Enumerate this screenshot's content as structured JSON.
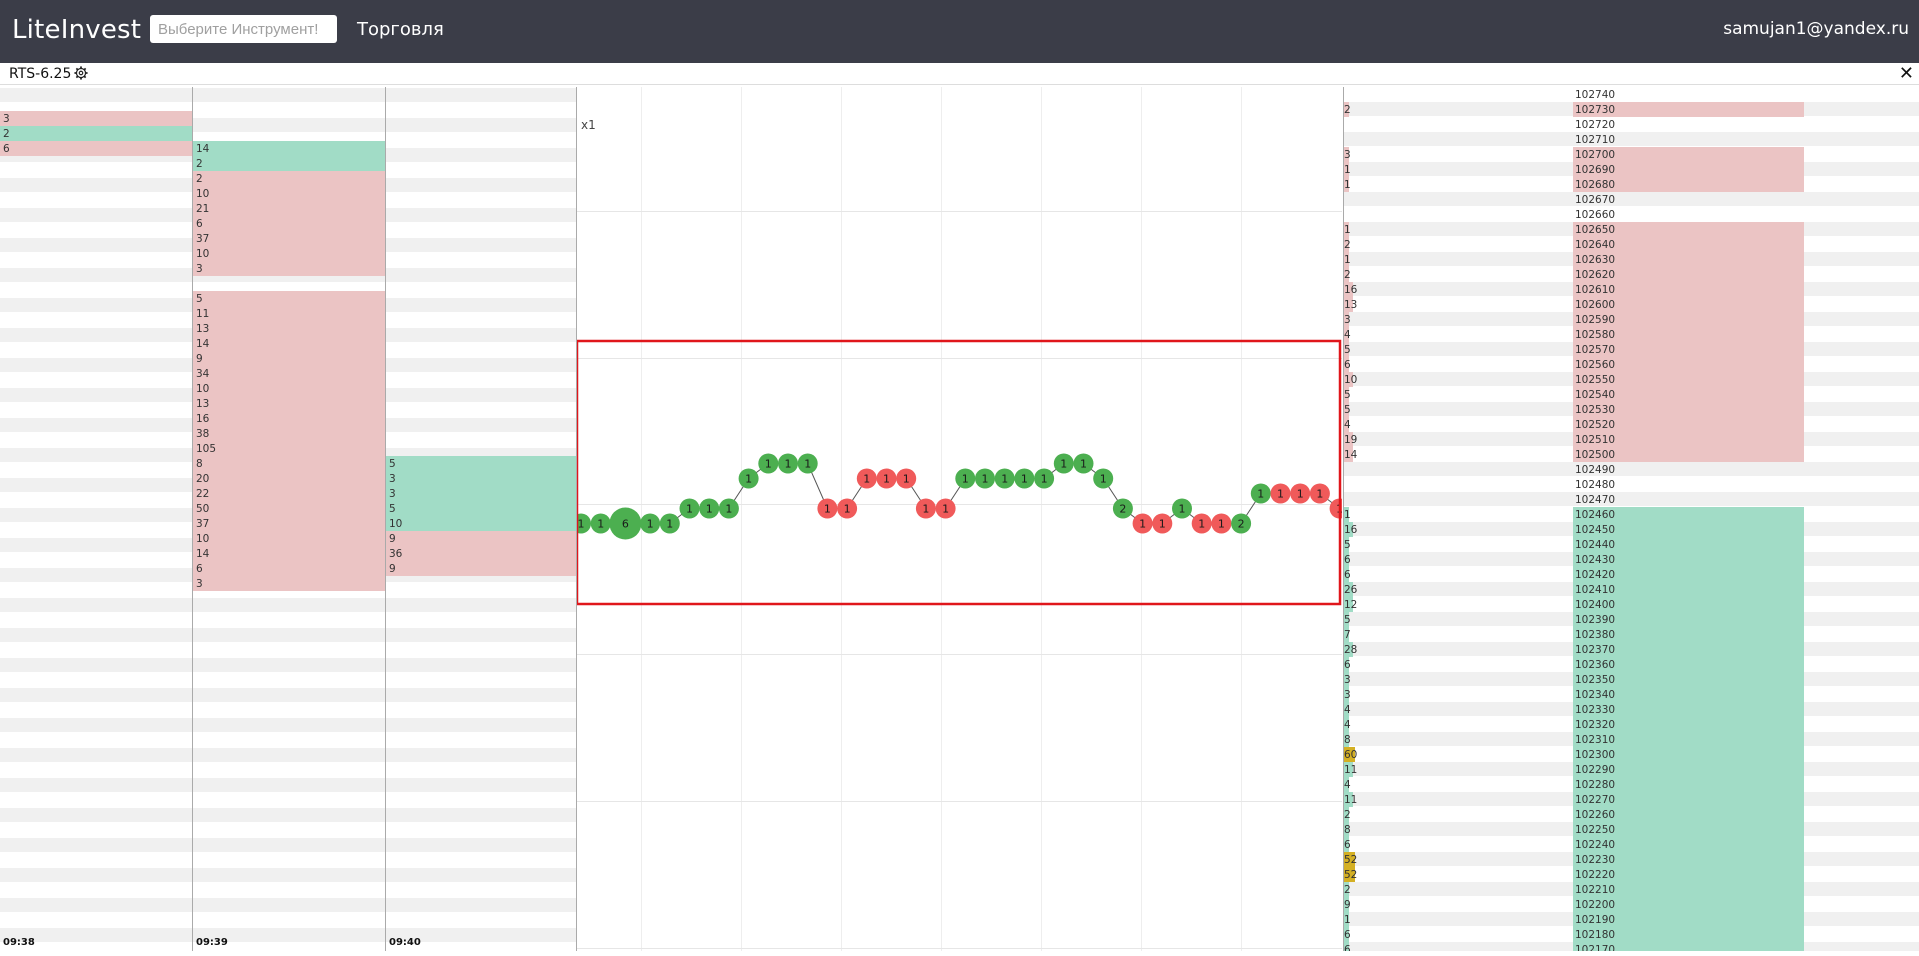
{
  "header": {
    "logo": "LiteInvest",
    "search_placeholder": "Выберите Инструмент!",
    "nav_trading": "Торговля",
    "user_email": "samujan1@yandex.ru"
  },
  "instrument": {
    "symbol": "RTS-6.25",
    "settings_icon": "gear-icon",
    "close_icon": "close-icon"
  },
  "colors": {
    "sell": "#ebc4c4",
    "buy": "#a1dcc6",
    "bubble_buy": "#4caf50",
    "bubble_sell": "#f05a5a",
    "highlight": "#e0161b",
    "header_bg": "#3b3d48",
    "yellow_mark": "#d4b024"
  },
  "time_columns": [
    {
      "time": "09:38",
      "rows": [
        {
          "row": 2,
          "v": "3",
          "side": "sell"
        },
        {
          "row": 3,
          "v": "2",
          "side": "buy"
        },
        {
          "row": 4,
          "v": "6",
          "side": "sell"
        }
      ]
    },
    {
      "time": "09:39",
      "rows": [
        {
          "row": 4,
          "v": "14",
          "side": "buy"
        },
        {
          "row": 5,
          "v": "2",
          "side": "buy"
        },
        {
          "row": 6,
          "v": "2",
          "side": "sell"
        },
        {
          "row": 7,
          "v": "10",
          "side": "sell"
        },
        {
          "row": 8,
          "v": "21",
          "side": "sell"
        },
        {
          "row": 9,
          "v": "6",
          "side": "sell"
        },
        {
          "row": 10,
          "v": "37",
          "side": "sell"
        },
        {
          "row": 11,
          "v": "10",
          "side": "sell"
        },
        {
          "row": 12,
          "v": "3",
          "side": "sell"
        },
        {
          "row": 14,
          "v": "5",
          "side": "sell"
        },
        {
          "row": 15,
          "v": "11",
          "side": "sell"
        },
        {
          "row": 16,
          "v": "13",
          "side": "sell"
        },
        {
          "row": 17,
          "v": "14",
          "side": "sell"
        },
        {
          "row": 18,
          "v": "9",
          "side": "sell"
        },
        {
          "row": 19,
          "v": "34",
          "side": "sell"
        },
        {
          "row": 20,
          "v": "10",
          "side": "sell"
        },
        {
          "row": 21,
          "v": "13",
          "side": "sell"
        },
        {
          "row": 22,
          "v": "16",
          "side": "sell"
        },
        {
          "row": 23,
          "v": "38",
          "side": "sell"
        },
        {
          "row": 24,
          "v": "105",
          "side": "sell"
        },
        {
          "row": 25,
          "v": "8",
          "side": "sell"
        },
        {
          "row": 26,
          "v": "20",
          "side": "sell"
        },
        {
          "row": 27,
          "v": "22",
          "side": "sell"
        },
        {
          "row": 28,
          "v": "50",
          "side": "sell"
        },
        {
          "row": 29,
          "v": "37",
          "side": "sell"
        },
        {
          "row": 30,
          "v": "10",
          "side": "sell"
        },
        {
          "row": 31,
          "v": "14",
          "side": "sell"
        },
        {
          "row": 32,
          "v": "6",
          "side": "sell"
        },
        {
          "row": 33,
          "v": "3",
          "side": "sell"
        }
      ]
    },
    {
      "time": "09:40",
      "rows": [
        {
          "row": 25,
          "v": "5",
          "side": "buy"
        },
        {
          "row": 26,
          "v": "3",
          "side": "buy"
        },
        {
          "row": 27,
          "v": "3",
          "side": "buy"
        },
        {
          "row": 28,
          "v": "5",
          "side": "buy"
        },
        {
          "row": 29,
          "v": "10",
          "side": "buy"
        },
        {
          "row": 30,
          "v": "9",
          "side": "sell"
        },
        {
          "row": 31,
          "v": "36",
          "side": "sell"
        },
        {
          "row": 32,
          "v": "9",
          "side": "sell"
        }
      ]
    }
  ],
  "chart": {
    "scale_label": "x1",
    "trades": [
      {
        "v": "1",
        "row": 29,
        "side": "buy"
      },
      {
        "v": "1",
        "row": 29,
        "side": "buy"
      },
      {
        "v": "6",
        "row": 29,
        "side": "buy",
        "big": true
      },
      {
        "v": "1",
        "row": 29,
        "side": "buy"
      },
      {
        "v": "1",
        "row": 29,
        "side": "buy"
      },
      {
        "v": "1",
        "row": 28,
        "side": "buy"
      },
      {
        "v": "1",
        "row": 28,
        "side": "buy"
      },
      {
        "v": "1",
        "row": 28,
        "side": "buy"
      },
      {
        "v": "1",
        "row": 26,
        "side": "buy"
      },
      {
        "v": "1",
        "row": 25,
        "side": "buy"
      },
      {
        "v": "1",
        "row": 25,
        "side": "buy"
      },
      {
        "v": "1",
        "row": 25,
        "side": "buy"
      },
      {
        "v": "1",
        "row": 28,
        "side": "sell"
      },
      {
        "v": "1",
        "row": 28,
        "side": "sell"
      },
      {
        "v": "1",
        "row": 26,
        "side": "sell"
      },
      {
        "v": "1",
        "row": 26,
        "side": "sell"
      },
      {
        "v": "1",
        "row": 26,
        "side": "sell"
      },
      {
        "v": "1",
        "row": 28,
        "side": "sell"
      },
      {
        "v": "1",
        "row": 28,
        "side": "sell"
      },
      {
        "v": "1",
        "row": 26,
        "side": "buy"
      },
      {
        "v": "1",
        "row": 26,
        "side": "buy"
      },
      {
        "v": "1",
        "row": 26,
        "side": "buy"
      },
      {
        "v": "1",
        "row": 26,
        "side": "buy"
      },
      {
        "v": "1",
        "row": 26,
        "side": "buy"
      },
      {
        "v": "1",
        "row": 25,
        "side": "buy"
      },
      {
        "v": "1",
        "row": 25,
        "side": "buy"
      },
      {
        "v": "1",
        "row": 26,
        "side": "buy"
      },
      {
        "v": "2",
        "row": 28,
        "side": "buy"
      },
      {
        "v": "1",
        "row": 29,
        "side": "sell"
      },
      {
        "v": "1",
        "row": 29,
        "side": "sell"
      },
      {
        "v": "1",
        "row": 28,
        "side": "buy"
      },
      {
        "v": "1",
        "row": 29,
        "side": "sell"
      },
      {
        "v": "1",
        "row": 29,
        "side": "sell"
      },
      {
        "v": "2",
        "row": 29,
        "side": "buy"
      },
      {
        "v": "1",
        "row": 27,
        "side": "buy"
      },
      {
        "v": "1",
        "row": 27,
        "side": "sell"
      },
      {
        "v": "1",
        "row": 27,
        "side": "sell"
      },
      {
        "v": "1",
        "row": 27,
        "side": "sell"
      },
      {
        "v": "1",
        "row": 28,
        "side": "sell"
      }
    ]
  },
  "ladder": [
    {
      "price": "102740",
      "vol": "",
      "side": "none"
    },
    {
      "price": "102730",
      "vol": "2",
      "side": "sell"
    },
    {
      "price": "102720",
      "vol": "",
      "side": "none"
    },
    {
      "price": "102710",
      "vol": "",
      "side": "none"
    },
    {
      "price": "102700",
      "vol": "3",
      "side": "sell"
    },
    {
      "price": "102690",
      "vol": "1",
      "side": "sell"
    },
    {
      "price": "102680",
      "vol": "1",
      "side": "sell"
    },
    {
      "price": "102670",
      "vol": "",
      "side": "none"
    },
    {
      "price": "102660",
      "vol": "",
      "side": "none"
    },
    {
      "price": "102650",
      "vol": "1",
      "side": "sell"
    },
    {
      "price": "102640",
      "vol": "2",
      "side": "sell"
    },
    {
      "price": "102630",
      "vol": "1",
      "side": "sell"
    },
    {
      "price": "102620",
      "vol": "2",
      "side": "sell"
    },
    {
      "price": "102610",
      "vol": "16",
      "side": "sell"
    },
    {
      "price": "102600",
      "vol": "13",
      "side": "sell"
    },
    {
      "price": "102590",
      "vol": "3",
      "side": "sell"
    },
    {
      "price": "102580",
      "vol": "4",
      "side": "sell"
    },
    {
      "price": "102570",
      "vol": "5",
      "side": "sell"
    },
    {
      "price": "102560",
      "vol": "6",
      "side": "sell"
    },
    {
      "price": "102550",
      "vol": "10",
      "side": "sell"
    },
    {
      "price": "102540",
      "vol": "5",
      "side": "sell"
    },
    {
      "price": "102530",
      "vol": "5",
      "side": "sell"
    },
    {
      "price": "102520",
      "vol": "4",
      "side": "sell"
    },
    {
      "price": "102510",
      "vol": "19",
      "side": "sell"
    },
    {
      "price": "102500",
      "vol": "14",
      "side": "sell"
    },
    {
      "price": "102490",
      "vol": "",
      "side": "none"
    },
    {
      "price": "102480",
      "vol": "",
      "side": "none"
    },
    {
      "price": "102470",
      "vol": "",
      "side": "none"
    },
    {
      "price": "102460",
      "vol": "1",
      "side": "buy"
    },
    {
      "price": "102450",
      "vol": "16",
      "side": "buy"
    },
    {
      "price": "102440",
      "vol": "5",
      "side": "buy"
    },
    {
      "price": "102430",
      "vol": "6",
      "side": "buy"
    },
    {
      "price": "102420",
      "vol": "6",
      "side": "buy"
    },
    {
      "price": "102410",
      "vol": "26",
      "side": "buy"
    },
    {
      "price": "102400",
      "vol": "12",
      "side": "buy"
    },
    {
      "price": "102390",
      "vol": "5",
      "side": "buy"
    },
    {
      "price": "102380",
      "vol": "7",
      "side": "buy"
    },
    {
      "price": "102370",
      "vol": "28",
      "side": "buy"
    },
    {
      "price": "102360",
      "vol": "6",
      "side": "buy"
    },
    {
      "price": "102350",
      "vol": "3",
      "side": "buy"
    },
    {
      "price": "102340",
      "vol": "3",
      "side": "buy"
    },
    {
      "price": "102330",
      "vol": "4",
      "side": "buy"
    },
    {
      "price": "102320",
      "vol": "4",
      "side": "buy"
    },
    {
      "price": "102310",
      "vol": "8",
      "side": "buy"
    },
    {
      "price": "102300",
      "vol": "60",
      "side": "buy"
    },
    {
      "price": "102290",
      "vol": "11",
      "side": "buy"
    },
    {
      "price": "102280",
      "vol": "4",
      "side": "buy"
    },
    {
      "price": "102270",
      "vol": "11",
      "side": "buy"
    },
    {
      "price": "102260",
      "vol": "2",
      "side": "buy"
    },
    {
      "price": "102250",
      "vol": "8",
      "side": "buy"
    },
    {
      "price": "102240",
      "vol": "6",
      "side": "buy"
    },
    {
      "price": "102230",
      "vol": "52",
      "side": "buy"
    },
    {
      "price": "102220",
      "vol": "52",
      "side": "buy"
    },
    {
      "price": "102210",
      "vol": "2",
      "side": "buy"
    },
    {
      "price": "102200",
      "vol": "9",
      "side": "buy"
    },
    {
      "price": "102190",
      "vol": "1",
      "side": "buy"
    },
    {
      "price": "102180",
      "vol": "6",
      "side": "buy"
    },
    {
      "price": "102170",
      "vol": "6",
      "side": "buy"
    }
  ]
}
